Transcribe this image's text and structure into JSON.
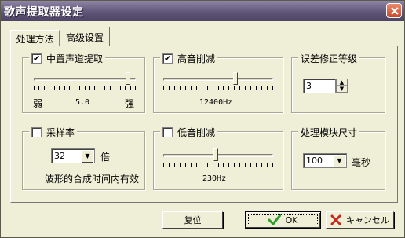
{
  "window": {
    "title": "歌声提取器设定"
  },
  "tabs": [
    {
      "label": "处理方法",
      "active": false
    },
    {
      "label": "高级设置",
      "active": true
    }
  ],
  "center_vocal": {
    "label": "中置声道提取",
    "checked": true,
    "value_text": "5.0",
    "min_label": "弱",
    "max_label": "强",
    "level": 0.92
  },
  "high_cut": {
    "label": "高音削减",
    "checked": true,
    "value_text": "12400Hz",
    "level": 0.66
  },
  "error_correction": {
    "label": "误差修正等级",
    "value": "3"
  },
  "sample_rate": {
    "label": "采样率",
    "checked": false,
    "value": "32",
    "unit": "倍",
    "note": "波形的合成时间内有效"
  },
  "low_cut": {
    "label": "低音削减",
    "checked": false,
    "value_text": "230Hz",
    "level": 0.48
  },
  "block_size": {
    "label": "处理模块尺寸",
    "value": "100",
    "unit": "毫秒"
  },
  "buttons": {
    "reset": "复位",
    "ok": "OK",
    "cancel": "キャンセル"
  },
  "colors": {
    "ok_check": "#2e9e2e",
    "cancel_x": "#c8281e",
    "titlebar": "#5f5678"
  },
  "icons": {
    "checkmark": "✔",
    "ok": "green-check-icon",
    "cancel": "red-x-icon"
  }
}
